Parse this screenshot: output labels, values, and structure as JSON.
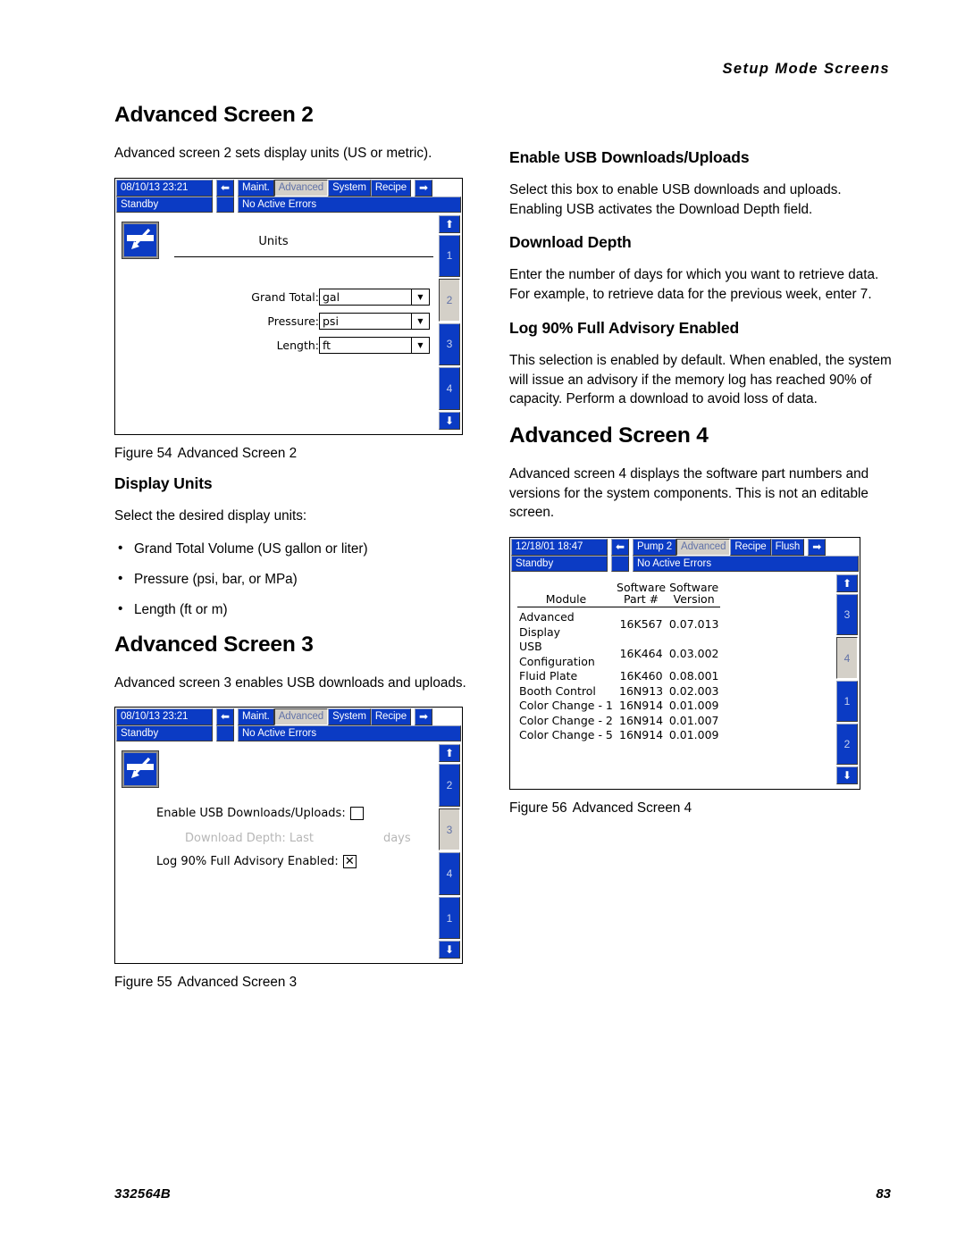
{
  "header": {
    "running_head": "Setup Mode Screens"
  },
  "footer": {
    "doc_number": "332564B",
    "page_number": "83"
  },
  "left_column": {
    "h1_screen2": "Advanced Screen 2",
    "intro_screen2": "Advanced screen 2 sets display units (US or metric).",
    "fig54_caption_num": "Figure 54",
    "fig54_caption_text": "Advanced Screen 2",
    "h2_display_units": "Display Units",
    "display_units_intro": "Select the desired display units:",
    "display_units_bullets": [
      "Grand Total Volume (US gallon or liter)",
      "Pressure (psi, bar, or MPa)",
      "Length (ft or m)"
    ],
    "h1_screen3": "Advanced Screen 3",
    "intro_screen3": "Advanced screen 3 enables USB downloads and uploads.",
    "fig55_caption_num": "Figure 55",
    "fig55_caption_text": "Advanced Screen 3"
  },
  "right_column": {
    "h2_enable_usb": "Enable USB Downloads/Uploads",
    "enable_usb_body": "Select this box to enable USB downloads and uploads. Enabling USB activates the Download Depth field.",
    "h2_download_depth": "Download Depth",
    "download_depth_body": "Enter the number of days for which you want to retrieve data. For example, to retrieve data for the previous week, enter 7.",
    "h2_log90": "Log 90% Full Advisory Enabled",
    "log90_body": "This selection is enabled by default. When enabled, the system will issue an advisory if the memory log has reached 90% of capacity. Perform a download to avoid loss of data.",
    "h1_screen4": "Advanced Screen 4",
    "intro_screen4": "Advanced screen 4 displays the software part numbers and versions for the system components. This is not an editable screen.",
    "fig56_caption_num": "Figure 56",
    "fig56_caption_text": "Advanced Screen 4"
  },
  "colors": {
    "hmi_blue": "#0b3bc4",
    "hmi_selected_gray": "#d4d0c8",
    "hmi_selected_text": "#6172a8",
    "hmi_chip_text": "#ffffff",
    "hmi_dim_text": "#b6b6b6"
  },
  "screen54": {
    "datetime": "08/10/13 23:21",
    "prev_icon": "left-arrow-icon",
    "next_icon": "right-arrow-icon",
    "tabs": [
      "Maint.",
      "Advanced",
      "System",
      "Recipe"
    ],
    "active_tab": "Advanced",
    "mode": "Standby",
    "errors": "No Active Errors",
    "edit_icon": "edit-pencil-icon",
    "panel_title": "Units",
    "fields": [
      {
        "label": "Grand Total:",
        "value": "gal"
      },
      {
        "label": "Pressure:",
        "value": "psi"
      },
      {
        "label": "Length:",
        "value": "ft"
      }
    ],
    "rail": {
      "up_icon": "up-arrow-icon",
      "down_icon": "down-arrow-icon",
      "items": [
        "1",
        "2",
        "3",
        "4"
      ],
      "selected": "2"
    }
  },
  "screen55": {
    "datetime": "08/10/13 23:21",
    "prev_icon": "left-arrow-icon",
    "next_icon": "right-arrow-icon",
    "tabs": [
      "Maint.",
      "Advanced",
      "System",
      "Recipe"
    ],
    "active_tab": "Advanced",
    "mode": "Standby",
    "errors": "No Active Errors",
    "edit_icon": "edit-pencil-icon",
    "rows": {
      "enable_usb_label": "Enable USB Downloads/Uploads:",
      "enable_usb_checked": false,
      "download_depth_label": "Download Depth: Last",
      "download_depth_value": "",
      "download_depth_units": "days",
      "log90_label": "Log 90% Full Advisory Enabled:",
      "log90_checked": true
    },
    "rail": {
      "up_icon": "up-arrow-icon",
      "down_icon": "down-arrow-icon",
      "items": [
        "2",
        "3",
        "4",
        "1"
      ],
      "selected": "3"
    }
  },
  "screen56": {
    "datetime": "12/18/01 18:47",
    "prev_icon": "left-arrow-icon",
    "next_icon": "right-arrow-icon",
    "tabs": [
      "Pump 2",
      "Advanced",
      "Recipe",
      "Flush"
    ],
    "active_tab": "Advanced",
    "mode": "Standby",
    "errors": "No Active Errors",
    "table": {
      "headers": [
        "Module",
        "Software\nPart #",
        "Software\nVersion"
      ],
      "header_module": "Module",
      "header_part_line1": "Software",
      "header_part_line2": "Part #",
      "header_ver_line1": "Software",
      "header_ver_line2": "Version",
      "rows": [
        {
          "module": "Advanced Display",
          "part": "16K567",
          "version": "0.07.013"
        },
        {
          "module": "USB Configuration",
          "part": "16K464",
          "version": "0.03.002"
        },
        {
          "module": "Fluid Plate",
          "part": "16K460",
          "version": "0.08.001"
        },
        {
          "module": "Booth Control",
          "part": "16N913",
          "version": "0.02.003"
        },
        {
          "module": "Color Change - 1",
          "part": "16N914",
          "version": "0.01.009"
        },
        {
          "module": "Color Change - 2",
          "part": "16N914",
          "version": "0.01.007"
        },
        {
          "module": "Color Change - 5",
          "part": "16N914",
          "version": "0.01.009"
        }
      ]
    },
    "rail": {
      "up_icon": "up-arrow-icon",
      "down_icon": "down-arrow-icon",
      "items": [
        "3",
        "4",
        "1",
        "2"
      ],
      "selected": "4"
    }
  }
}
